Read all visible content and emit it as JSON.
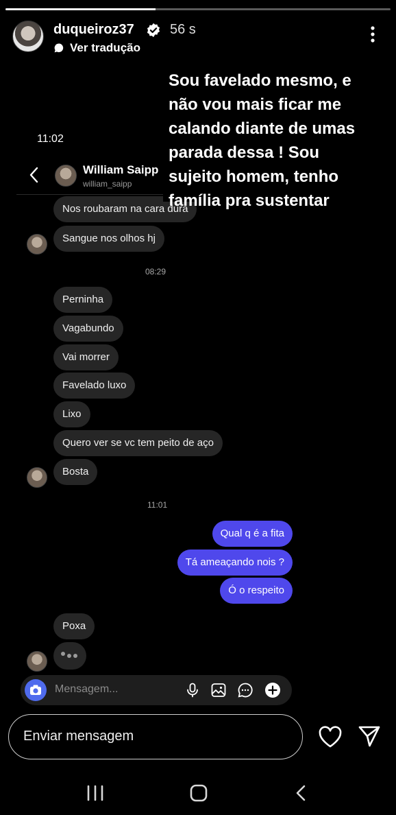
{
  "story": {
    "progress": 0.39,
    "username": "duqueiroz37",
    "time_ago": "56 s",
    "translate_label": "Ver tradução",
    "caption_lines": [
      "Sou favelado mesmo, e",
      "não vou mais ficar me",
      "calando diante de umas",
      "parada dessa ! Sou",
      "sujeito homem, tenho",
      "família pra sustentar"
    ]
  },
  "dm": {
    "status_time": "11:02",
    "contact_name": "William Saipp",
    "contact_handle": "william_saipp",
    "messages_a": [
      "Nos roubaram na cara dura",
      "Sangue nos olhos hj"
    ],
    "stamp_1": "08:29",
    "messages_b": [
      "Perninha",
      "Vagabundo",
      "Vai morrer",
      "Favelado luxo",
      "Lixo",
      "Quero ver se vc tem peito de aço",
      "Bosta"
    ],
    "stamp_2": "11:01",
    "messages_out": [
      "Qual q é a fita",
      "Tá ameaçando nois ?",
      "Ó o respeito"
    ],
    "messages_c": [
      "Poxa"
    ],
    "composer_placeholder": "Mensagem..."
  },
  "reply": {
    "placeholder": "Enviar mensagem"
  },
  "colors": {
    "outgoing_bubble": "#4f48ec",
    "incoming_bubble": "#262626",
    "camera_button": "#4f6bed"
  }
}
